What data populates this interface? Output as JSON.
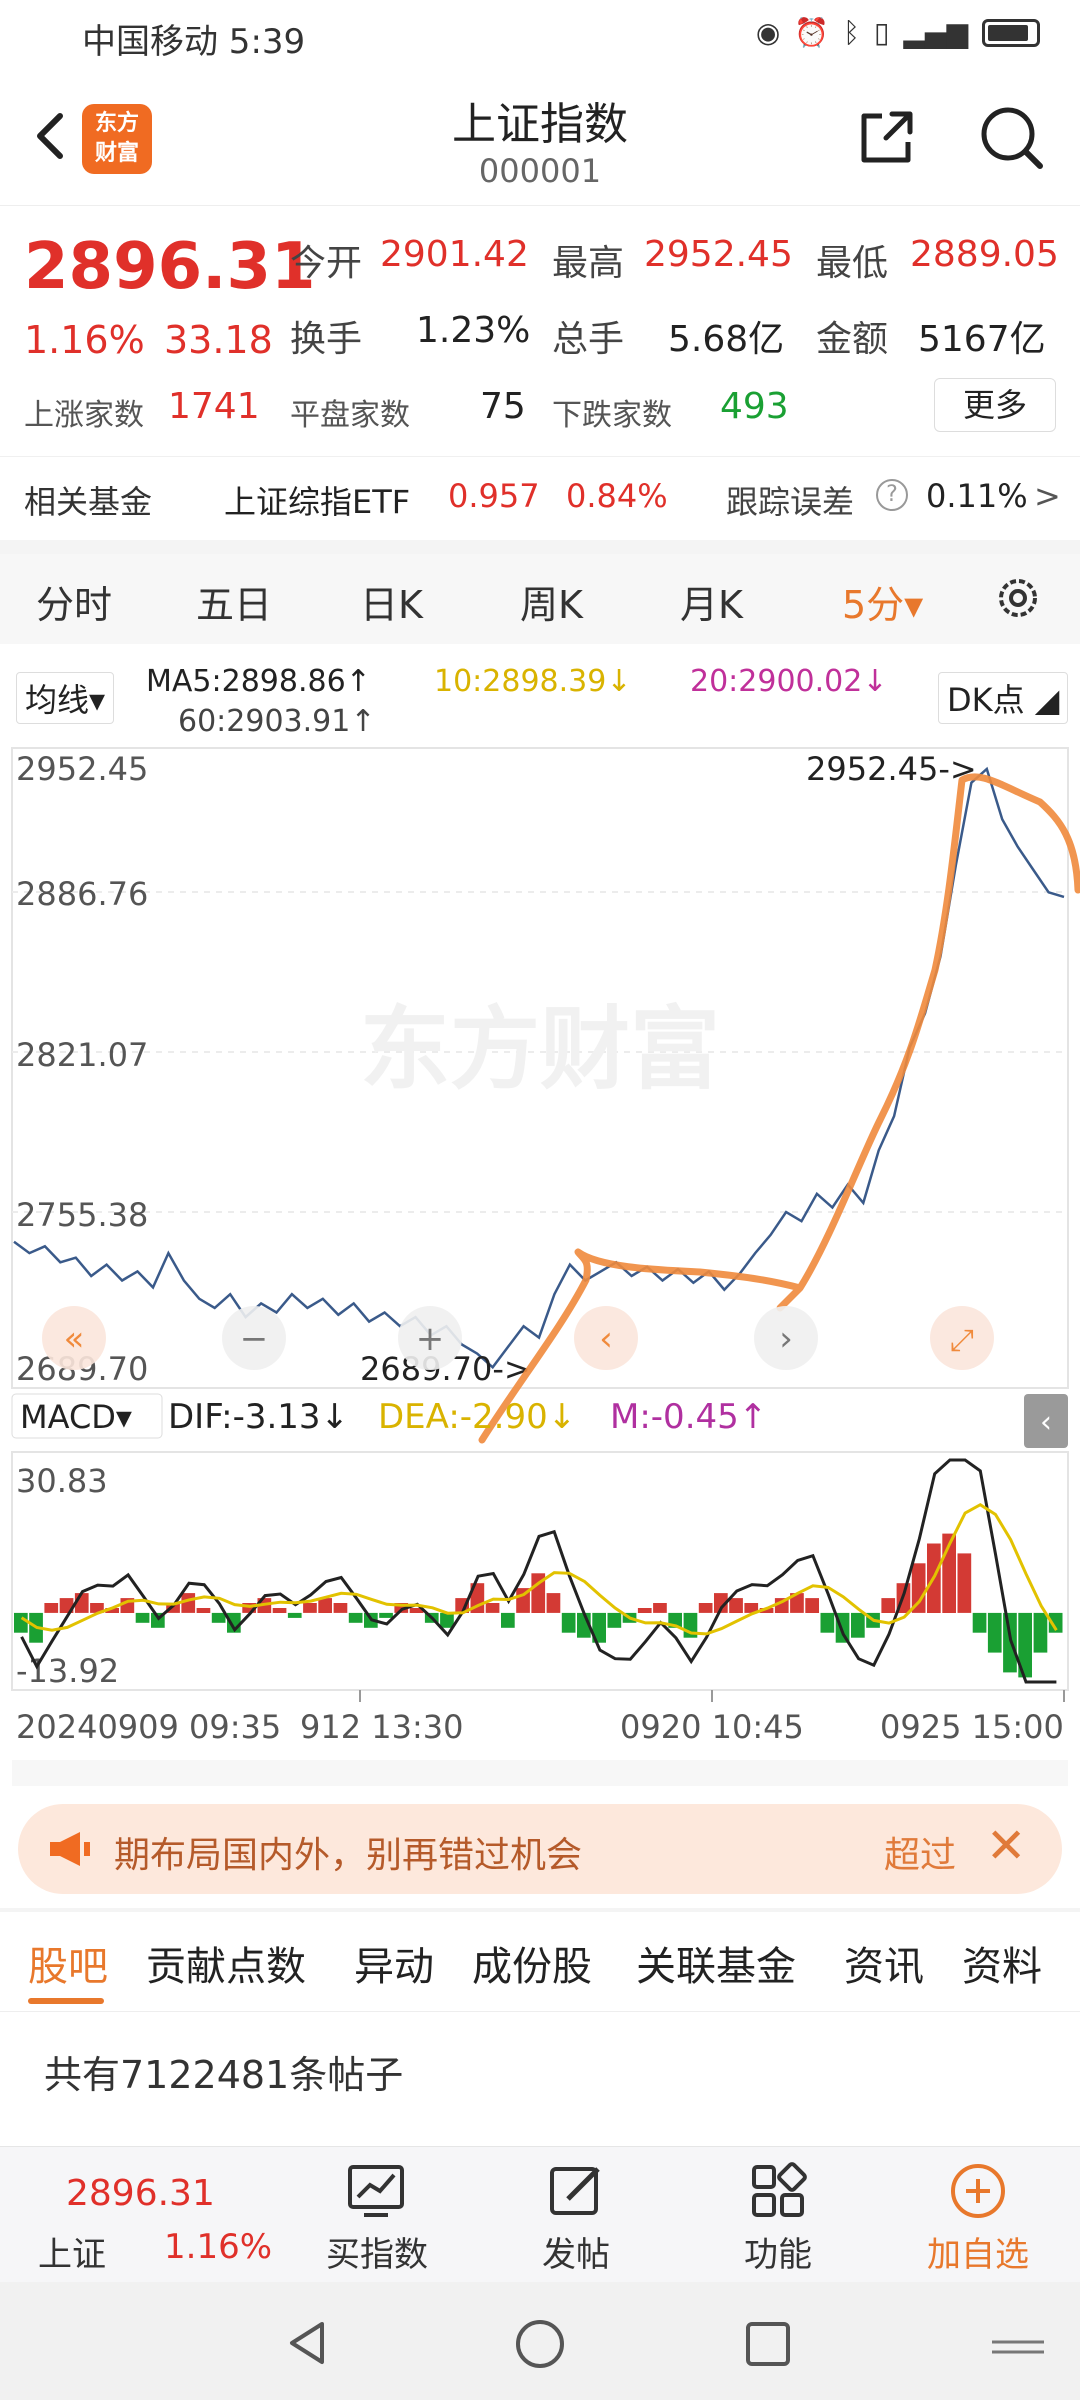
{
  "status_bar": {
    "carrier_time": "中国移动 5:39"
  },
  "header": {
    "title": "上证指数",
    "code": "000001",
    "logo_text": "东方财富"
  },
  "quote": {
    "price": "2896.31",
    "change_pct": "1.16%",
    "change": "33.18",
    "open_label": "今开",
    "open": "2901.42",
    "high_label": "最高",
    "high": "2952.45",
    "low_label": "最低",
    "low": "2889.05",
    "turnover_label": "换手",
    "turnover": "1.23%",
    "volume_label": "总手",
    "volume": "5.68亿",
    "amount_label": "金额",
    "amount": "5167亿",
    "up_label": "上涨家数",
    "up": "1741",
    "flat_label": "平盘家数",
    "flat": "75",
    "down_label": "下跌家数",
    "down": "493",
    "more_button": "更多"
  },
  "fund_row": {
    "label": "相关基金",
    "etf_name": "上证综指ETF",
    "etf_price": "0.957",
    "etf_pct": "0.84%",
    "tracking_label": "跟踪误差",
    "tracking_value": "0.11%",
    "arrow": ">"
  },
  "period_tabs": [
    {
      "label": "分时"
    },
    {
      "label": "五日"
    },
    {
      "label": "日K"
    },
    {
      "label": "周K"
    },
    {
      "label": "月K"
    },
    {
      "label": "5分▾"
    }
  ],
  "ma_row": {
    "selector": "均线▾",
    "ma5": "MA5:2898.86↑",
    "ma10": "10:2898.39↓",
    "ma20": "20:2900.02↓",
    "ma60": "60:2903.91↑",
    "dk_button": "DK点 ◢"
  },
  "macd_row": {
    "selector": "MACD▾",
    "dif": "DIF:-3.13↓",
    "dea": "DEA:-2.90↓",
    "m": "M:-0.45↑"
  },
  "chart_labels": {
    "watermark": "东方财富",
    "high_marker": "2952.45->",
    "low_marker": "2689.70->",
    "macd_top": "30.83",
    "macd_bottom": "-13.92",
    "x_tick_1": "20240909 09:35",
    "x_tick_2": "912 13:30",
    "x_tick_3": "0920 10:45",
    "x_tick_4": "0925 15:00"
  },
  "chart_data": {
    "type": "line",
    "y_axis_ticks": [
      "2952.45",
      "2886.76",
      "2821.07",
      "2755.38",
      "2689.70"
    ],
    "ylim": [
      2689.7,
      2952.45
    ],
    "x_tick_labels": [
      "20240909 09:35",
      "912 13:30",
      "0920 10:45",
      "0925 15:00"
    ],
    "series": [
      {
        "values": [
          2745,
          2740,
          2743,
          2736,
          2738,
          2730,
          2735,
          2728,
          2732,
          2725,
          2740,
          2728,
          2720,
          2716,
          2722,
          2712,
          2718,
          2714,
          2722,
          2716,
          2720,
          2713,
          2718,
          2710,
          2714,
          2708,
          2712,
          2704,
          2708,
          2700,
          2696,
          2690,
          2699,
          2708,
          2703,
          2722,
          2735,
          2728,
          2732,
          2736,
          2730,
          2734,
          2728,
          2733,
          2727,
          2732,
          2724,
          2731,
          2740,
          2748,
          2758,
          2754,
          2766,
          2760,
          2770,
          2762,
          2785,
          2800,
          2830,
          2845,
          2870,
          2910,
          2946,
          2952,
          2930,
          2918,
          2908,
          2898,
          2896
        ]
      }
    ],
    "macd_range": [
      -13.92,
      30.83
    ],
    "macd_histogram": [
      -4,
      -6,
      2,
      3,
      4,
      2,
      1,
      3,
      -2,
      -3,
      2,
      4,
      1,
      -2,
      -4,
      2,
      3,
      1,
      -1,
      2,
      3,
      2,
      -2,
      -3,
      -1,
      2,
      1,
      -2,
      -3,
      3,
      6,
      2,
      -3,
      5,
      8,
      4,
      -4,
      -5,
      -6,
      -3,
      -2,
      1,
      2,
      -3,
      -5,
      2,
      4,
      3,
      2,
      1,
      3,
      4,
      3,
      -4,
      -6,
      -5,
      -3,
      3,
      6,
      10,
      14,
      16,
      12,
      -4,
      -8,
      -12,
      -13,
      -8,
      -4
    ]
  },
  "banner": {
    "text": "期布局国内外，别再错过机会",
    "more": "超过",
    "close": "✕"
  },
  "bottom_tabs": [
    {
      "label": "股吧"
    },
    {
      "label": "贡献点数"
    },
    {
      "label": "异动"
    },
    {
      "label": "成份股"
    },
    {
      "label": "关联基金"
    },
    {
      "label": "资讯"
    },
    {
      "label": "资料"
    }
  ],
  "posts_count": "共有7122481条帖子",
  "bottom_bar": {
    "mini_price": "2896.31",
    "mini_name": "上证",
    "mini_pct": "1.16%",
    "buy_index": "买指数",
    "post": "发帖",
    "functions": "功能",
    "add_watch": "加自选"
  }
}
